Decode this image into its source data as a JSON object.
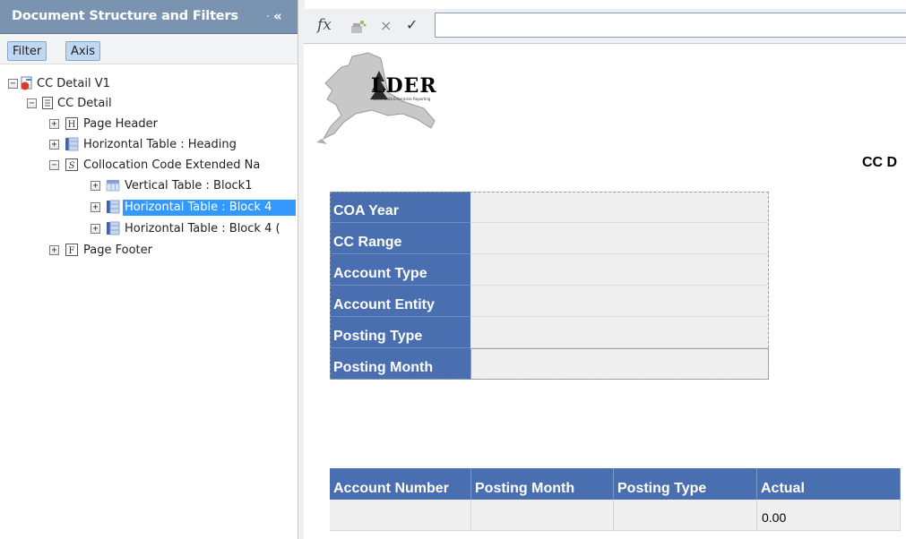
{
  "panel": {
    "title": "Document Structure and Filters",
    "dot": "·",
    "collapse": "«",
    "tabs": [
      "Filter",
      "Axis"
    ]
  },
  "tree": [
    {
      "label": "CC Detail V1",
      "toggle": "−",
      "icon": "document-icon"
    },
    {
      "label": "CC Detail",
      "toggle": "−",
      "icon": "report-icon"
    },
    {
      "label": "Page Header",
      "toggle": "+",
      "icon": "header-icon",
      "icon_letter": "H"
    },
    {
      "label": "Horizontal Table : Heading",
      "toggle": "+",
      "icon": "horizontal-table-icon"
    },
    {
      "label": "Collocation Code Extended Na",
      "toggle": "−",
      "icon": "section-icon",
      "icon_letter": "S"
    },
    {
      "label": "Vertical Table : Block1",
      "toggle": "+",
      "icon": "vertical-table-icon"
    },
    {
      "label": "Horizontal Table : Block 4",
      "toggle": "+",
      "icon": "horizontal-table-icon",
      "selected": true
    },
    {
      "label": "Horizontal Table : Block 4 (",
      "toggle": "+",
      "icon": "horizontal-table-icon"
    },
    {
      "label": "Page Footer",
      "toggle": "+",
      "icon": "footer-icon",
      "icon_letter": "F"
    }
  ],
  "formula_bar": {
    "fx": "fx",
    "cancel": "×",
    "validate": "✓",
    "value": ""
  },
  "report": {
    "logo_text": "LDER",
    "logo_sub": "Alaska Data Enterprise Reporting",
    "title": "CC D",
    "vertical_table": [
      "COA Year",
      "CC Range",
      "Account Type",
      "Account Entity",
      "Posting Type",
      "Posting Month"
    ],
    "horizontal_table": {
      "headers": [
        "Account Number",
        "Posting Month",
        "Posting Type",
        "Actual"
      ],
      "row": [
        "",
        "",
        "",
        "0.00"
      ]
    }
  },
  "colors": {
    "panel_header": "#7a93b1",
    "table_header": "#4a6fb0",
    "selection": "#3399ff",
    "cell_background": "#efefef"
  }
}
